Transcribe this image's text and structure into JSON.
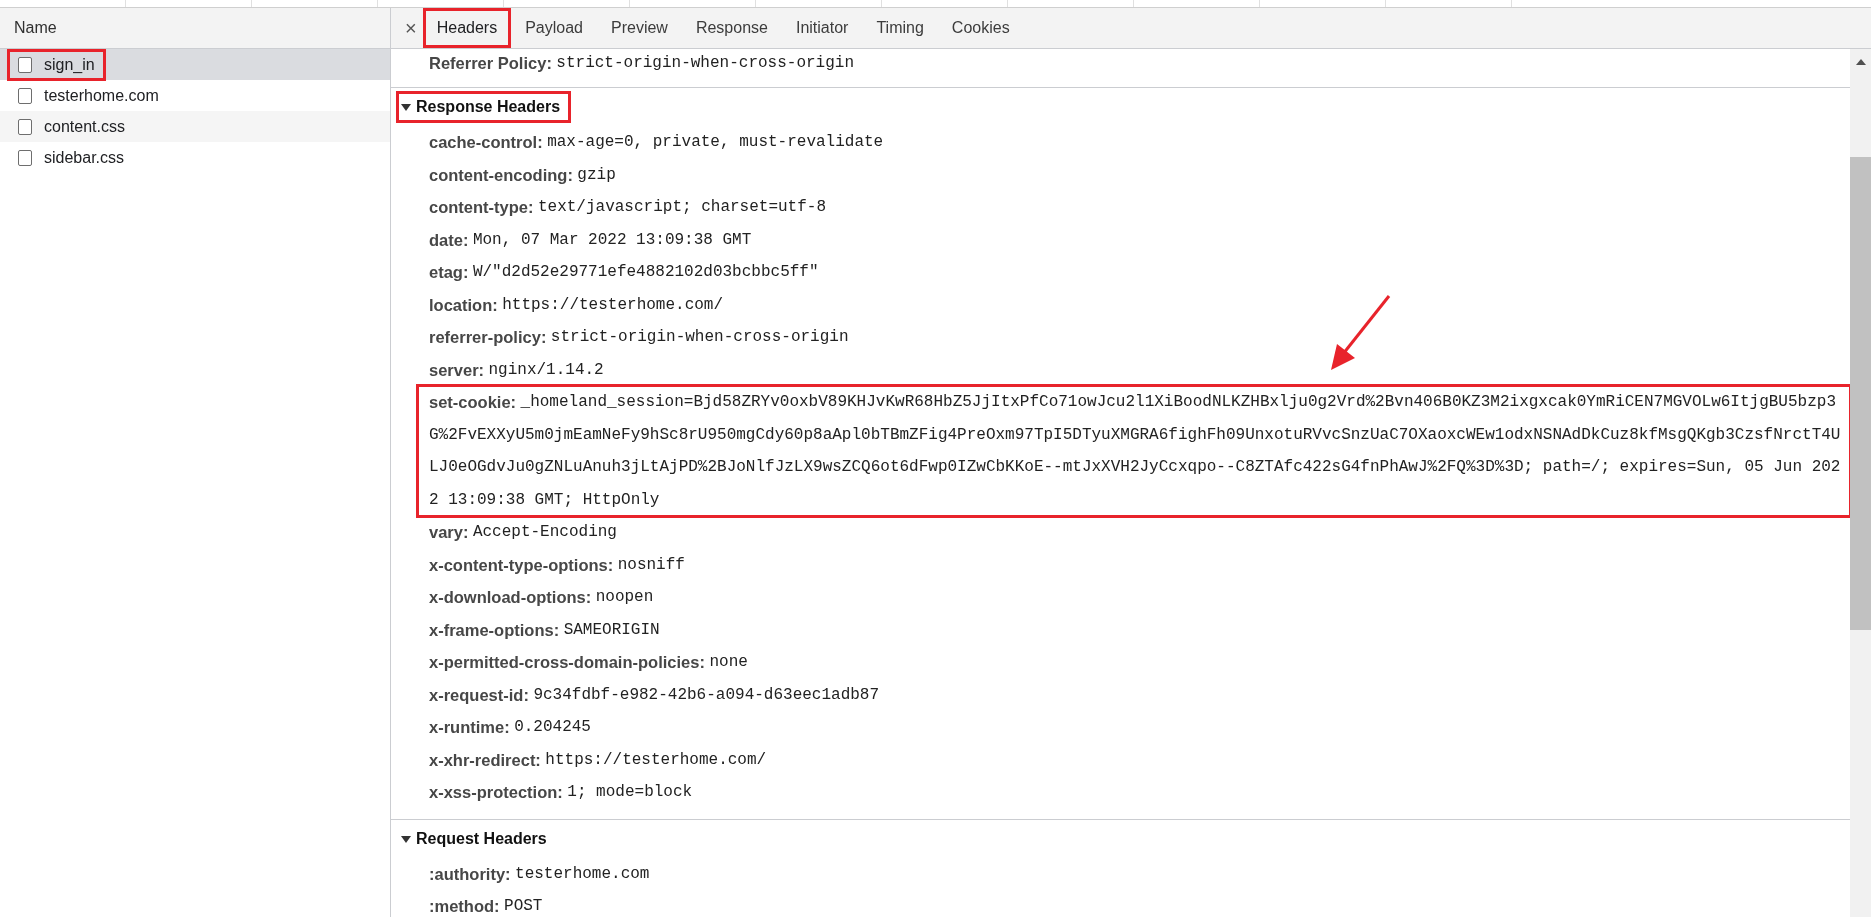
{
  "name_column": {
    "heading": "Name"
  },
  "requests": [
    {
      "name": "sign_in",
      "selected": true,
      "highlighted": true
    },
    {
      "name": "testerhome.com",
      "selected": false,
      "highlighted": false
    },
    {
      "name": "content.css",
      "selected": false,
      "highlighted": false
    },
    {
      "name": "sidebar.css",
      "selected": false,
      "highlighted": false
    }
  ],
  "detail": {
    "close": "×",
    "tabs": [
      {
        "label": "Headers",
        "selected": true,
        "highlighted": true
      },
      {
        "label": "Payload",
        "selected": false,
        "highlighted": false
      },
      {
        "label": "Preview",
        "selected": false,
        "highlighted": false
      },
      {
        "label": "Response",
        "selected": false,
        "highlighted": false
      },
      {
        "label": "Initiator",
        "selected": false,
        "highlighted": false
      },
      {
        "label": "Timing",
        "selected": false,
        "highlighted": false
      },
      {
        "label": "Cookies",
        "selected": false,
        "highlighted": false
      }
    ],
    "general_tail": [
      {
        "key": "Referrer Policy:",
        "value": "strict-origin-when-cross-origin"
      }
    ],
    "sections": [
      {
        "title": "Response Headers",
        "expanded": true,
        "highlighted": true,
        "headers": [
          {
            "key": "cache-control:",
            "value": "max-age=0, private, must-revalidate",
            "highlighted": false
          },
          {
            "key": "content-encoding:",
            "value": "gzip",
            "highlighted": false
          },
          {
            "key": "content-type:",
            "value": "text/javascript; charset=utf-8",
            "highlighted": false
          },
          {
            "key": "date:",
            "value": "Mon, 07 Mar 2022 13:09:38 GMT",
            "highlighted": false
          },
          {
            "key": "etag:",
            "value": "W/\"d2d52e29771efe4882102d03bcbbc5ff\"",
            "highlighted": false
          },
          {
            "key": "location:",
            "value": "https://testerhome.com/",
            "highlighted": false
          },
          {
            "key": "referrer-policy:",
            "value": "strict-origin-when-cross-origin",
            "highlighted": false
          },
          {
            "key": "server:",
            "value": "nginx/1.14.2",
            "highlighted": false
          },
          {
            "key": "set-cookie:",
            "value": "_homeland_session=Bjd58ZRYv0oxbV89KHJvKwR68HbZ5JjItxPfCo71owJcu2l1XiBoodNLKZHBxlju0g2Vrd%2Bvn406B0KZ3M2ixgxcak0YmRiCEN7MGVOLw6ItjgBU5bzp3G%2FvEXXyU5m0jmEamNeFy9hSc8rU950mgCdy60p8aApl0bTBmZFig4PreOxm97TpI5DTyuXMGRA6fighFh09UnxotuRVvcSnzUaC7OXaoxcWEw1odxNSNAdDkCuz8kfMsgQKgb3CzsfNrctT4ULJ0eOGdvJu0gZNLuAnuh3jLtAjPD%2BJoNlfJzLX9wsZCQ6ot6dFwp0IZwCbKKoE--mtJxXVH2JyCcxqpo--C8ZTAfc422sG4fnPhAwJ%2FQ%3D%3D; path=/; expires=Sun, 05 Jun 2022 13:09:38 GMT; HttpOnly",
            "highlighted": true
          },
          {
            "key": "vary:",
            "value": "Accept-Encoding",
            "highlighted": false
          },
          {
            "key": "x-content-type-options:",
            "value": "nosniff",
            "highlighted": false
          },
          {
            "key": "x-download-options:",
            "value": "noopen",
            "highlighted": false
          },
          {
            "key": "x-frame-options:",
            "value": "SAMEORIGIN",
            "highlighted": false
          },
          {
            "key": "x-permitted-cross-domain-policies:",
            "value": "none",
            "highlighted": false
          },
          {
            "key": "x-request-id:",
            "value": "9c34fdbf-e982-42b6-a094-d63eec1adb87",
            "highlighted": false
          },
          {
            "key": "x-runtime:",
            "value": "0.204245",
            "highlighted": false
          },
          {
            "key": "x-xhr-redirect:",
            "value": "https://testerhome.com/",
            "highlighted": false
          },
          {
            "key": "x-xss-protection:",
            "value": "1; mode=block",
            "highlighted": false
          }
        ]
      },
      {
        "title": "Request Headers",
        "expanded": true,
        "highlighted": false,
        "headers": [
          {
            "key": ":authority:",
            "value": "testerhome.com",
            "highlighted": false
          },
          {
            "key": ":method:",
            "value": "POST",
            "highlighted": false
          }
        ]
      }
    ]
  }
}
